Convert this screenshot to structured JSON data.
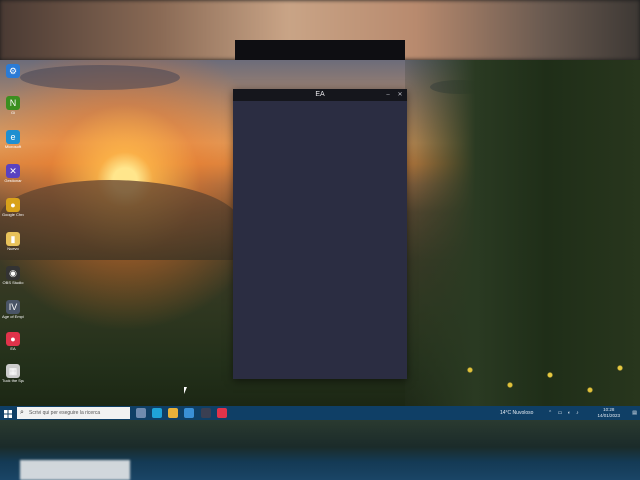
{
  "window": {
    "title": "EA",
    "minimize_icon": "minimize-icon",
    "close_icon": "close-icon",
    "minimize_glyph": "–",
    "close_glyph": "✕",
    "body_color": "#2b2d42",
    "titlebar_color": "#15161c"
  },
  "desktop": {
    "icons": [
      {
        "label": "",
        "icon": "windows-settings-icon",
        "color": "#2b7bd6",
        "glyph": "⚙"
      },
      {
        "label": "Gi",
        "icon": "nvidia-icon",
        "color": "#3b8f1f",
        "glyph": "N"
      },
      {
        "label": "Microsoft",
        "icon": "edge-icon",
        "color": "#1f8fd0",
        "glyph": "e"
      },
      {
        "label": "Gestionar",
        "icon": "tools-icon",
        "color": "#5a42c0",
        "glyph": "✕"
      },
      {
        "label": "Google Chrome",
        "icon": "chrome-icon",
        "color": "#d9a21a",
        "glyph": "●"
      },
      {
        "label": "Nuevo",
        "icon": "folder-icon",
        "color": "#e8c25a",
        "glyph": "▮"
      },
      {
        "label": "OBS Studio",
        "icon": "obs-icon",
        "color": "#333333",
        "glyph": "◉"
      },
      {
        "label": "Age of Empires IV",
        "icon": "aoe-icon",
        "color": "#4a5566",
        "glyph": "IV"
      },
      {
        "label": "EA",
        "icon": "ea-app-icon",
        "color": "#e0334a",
        "glyph": "●"
      },
      {
        "label": "Tuck the Space",
        "icon": "game-icon",
        "color": "#cccccc",
        "glyph": "▦"
      }
    ]
  },
  "taskbar": {
    "start_icon": "windows-start-icon",
    "search_placeholder": "Scrivi qui per eseguire la ricerca",
    "search_glyph": "⌕",
    "apps": [
      {
        "icon": "task-view-icon",
        "color": "#6f8bb0"
      },
      {
        "icon": "edge-taskbar-icon",
        "color": "#1fa2d8"
      },
      {
        "icon": "file-explorer-icon",
        "color": "#e8b13a"
      },
      {
        "icon": "mail-icon",
        "color": "#3a8fd6"
      },
      {
        "icon": "steam-icon",
        "color": "#3a3f52"
      },
      {
        "icon": "ea-taskbar-icon",
        "color": "#e0334a"
      }
    ],
    "weather": "14°C Nuvoloso",
    "clock_time": "10:28",
    "clock_date": "14/01/2023",
    "colors": {
      "bar": "#0f3f66"
    }
  }
}
